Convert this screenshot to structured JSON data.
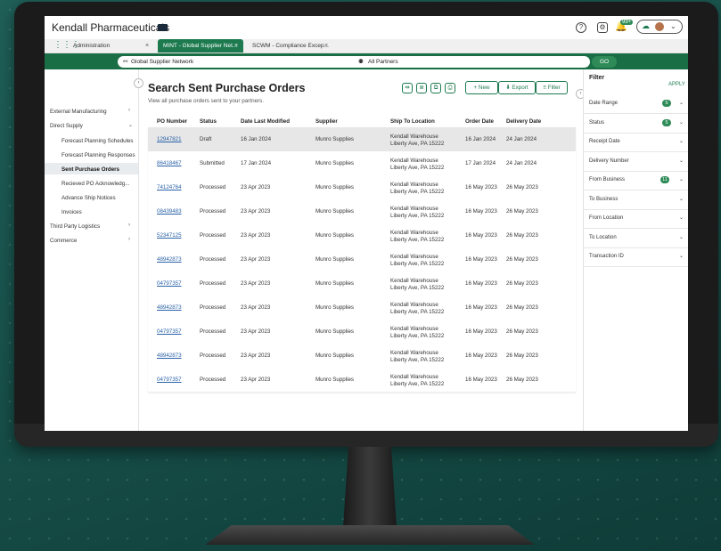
{
  "app": {
    "title": "Kendall Pharmaceuticals",
    "notification_count": "99+"
  },
  "tabs": [
    {
      "label": "Administration"
    },
    {
      "label": "MINT - Global Supplier Net..."
    },
    {
      "label": "SCWM - Compliance Excep..."
    }
  ],
  "search": {
    "network": "Global Supplier Network",
    "partners": "All Partners",
    "go": "GO"
  },
  "sidebar": {
    "items": [
      {
        "label": "External Manufacturing"
      },
      {
        "label": "Direct Supply"
      },
      {
        "label": "Forecast Planning Schedules"
      },
      {
        "label": "Forecast Planning Responses"
      },
      {
        "label": "Sent Purchase Orders"
      },
      {
        "label": "Recieved PO Acknowledg..."
      },
      {
        "label": "Advance Ship Notices"
      },
      {
        "label": "Invoices"
      },
      {
        "label": "Third Party Logistics"
      },
      {
        "label": "Commerce"
      }
    ]
  },
  "main": {
    "title": "Search Sent Purchase Orders",
    "subtitle": "View all purchase orders sent to your partners.",
    "toolbar": {
      "new": "New",
      "export": "Export",
      "filter": "Filter"
    },
    "columns": [
      "PO Number",
      "Status",
      "Date Last Modified",
      "Supplier",
      "Ship To Location",
      "Order Date",
      "Delivery Date"
    ],
    "rows": [
      {
        "po": "12947821",
        "status": "Draft",
        "modified": "16 Jan 2024",
        "supplier": "Munro Supplies",
        "loc1": "Kendall Warehouse",
        "loc2": "Liberty Ave, PA 15222",
        "order": "16 Jan 2024",
        "delivery": "24 Jan 2024"
      },
      {
        "po": "86418467",
        "status": "Submitted",
        "modified": "17 Jan 2024",
        "supplier": "Munro Supplies",
        "loc1": "Kendall Warehouse",
        "loc2": "Liberty Ave, PA 15222",
        "order": "17 Jan 2024",
        "delivery": "24 Jan 2024"
      },
      {
        "po": "74124764",
        "status": "Processed",
        "modified": "23 Apr 2023",
        "supplier": "Munro Supplies",
        "loc1": "Kendall Warehouse",
        "loc2": "Liberty Ave, PA 15222",
        "order": "16 May 2023",
        "delivery": "26 May 2023"
      },
      {
        "po": "08439483",
        "status": "Processed",
        "modified": "23 Apr 2023",
        "supplier": "Munro Supplies",
        "loc1": "Kendall Warehouse",
        "loc2": "Liberty Ave, PA 15222",
        "order": "16 May 2023",
        "delivery": "26 May 2023"
      },
      {
        "po": "52347125",
        "status": "Processed",
        "modified": "23 Apr 2023",
        "supplier": "Munro Supplies",
        "loc1": "Kendall Warehouse",
        "loc2": "Liberty Ave, PA 15222",
        "order": "16 May 2023",
        "delivery": "26 May 2023"
      },
      {
        "po": "48942873",
        "status": "Processed",
        "modified": "23 Apr 2023",
        "supplier": "Munro Supplies",
        "loc1": "Kendall Warehouse",
        "loc2": "Liberty Ave, PA 15222",
        "order": "16 May 2023",
        "delivery": "26 May 2023"
      },
      {
        "po": "04797357",
        "status": "Processed",
        "modified": "23 Apr 2023",
        "supplier": "Munro Supplies",
        "loc1": "Kendall Warehouse",
        "loc2": "Liberty Ave, PA 15222",
        "order": "16 May 2023",
        "delivery": "26 May 2023"
      },
      {
        "po": "48942873",
        "status": "Processed",
        "modified": "23 Apr 2023",
        "supplier": "Munro Supplies",
        "loc1": "Kendall Warehouse",
        "loc2": "Liberty Ave, PA 15222",
        "order": "16 May 2023",
        "delivery": "26 May 2023"
      },
      {
        "po": "04797357",
        "status": "Processed",
        "modified": "23 Apr 2023",
        "supplier": "Munro Supplies",
        "loc1": "Kendall Warehouse",
        "loc2": "Liberty Ave, PA 15222",
        "order": "16 May 2023",
        "delivery": "26 May 2023"
      },
      {
        "po": "48942873",
        "status": "Processed",
        "modified": "23 Apr 2023",
        "supplier": "Munro Supplies",
        "loc1": "Kendall Warehouse",
        "loc2": "Liberty Ave, PA 15222",
        "order": "16 May 2023",
        "delivery": "26 May 2023"
      },
      {
        "po": "04797357",
        "status": "Processed",
        "modified": "23 Apr 2023",
        "supplier": "Munro Supplies",
        "loc1": "Kendall Warehouse",
        "loc2": "Liberty Ave, PA 15222",
        "order": "16 May 2023",
        "delivery": "26 May 2023"
      }
    ]
  },
  "filter": {
    "title": "Filter",
    "apply": "APPLY",
    "items": [
      {
        "label": "Date Range",
        "badge": "5"
      },
      {
        "label": "Status",
        "badge": "5"
      },
      {
        "label": "Receipt Date",
        "badge": ""
      },
      {
        "label": "Delivery Number",
        "badge": ""
      },
      {
        "label": "From Business",
        "badge": "11"
      },
      {
        "label": "To Business",
        "badge": ""
      },
      {
        "label": "From Location",
        "badge": ""
      },
      {
        "label": "To Location",
        "badge": ""
      },
      {
        "label": "Transaction ID",
        "badge": ""
      }
    ]
  },
  "colors": {
    "accent": "#1d7a4f",
    "link": "#2a62a8",
    "background": "#18504a"
  }
}
